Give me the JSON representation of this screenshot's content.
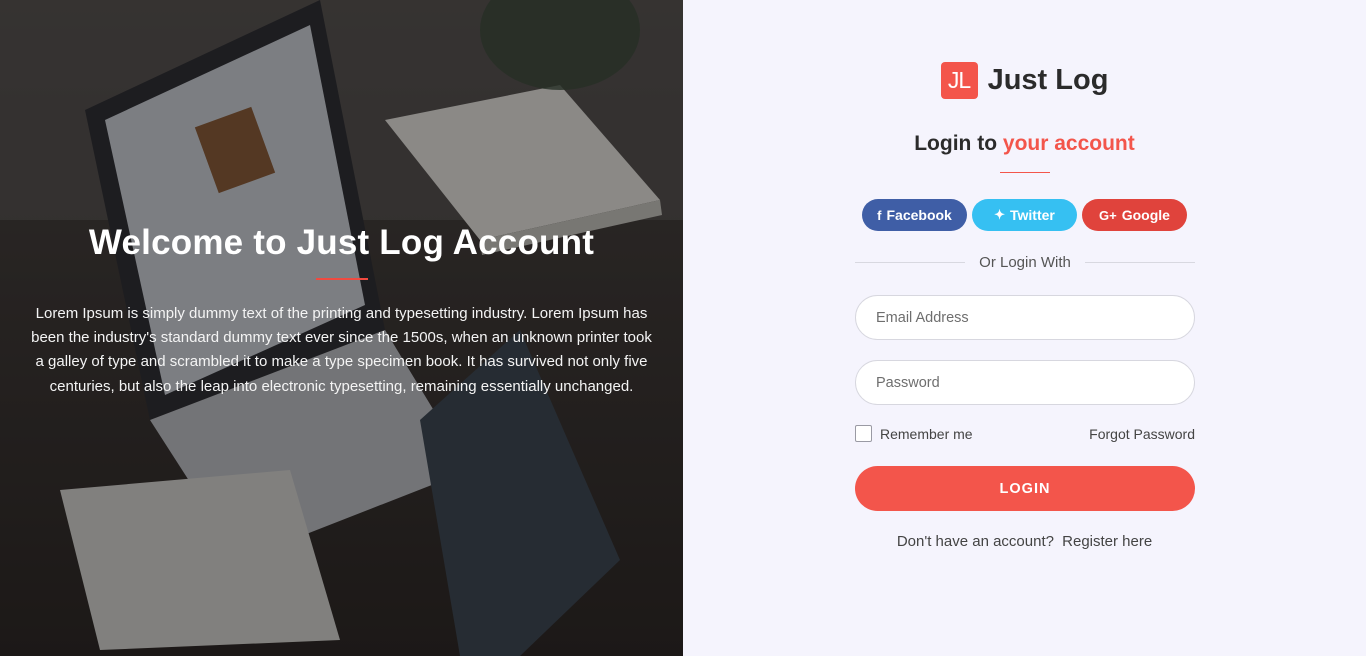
{
  "hero": {
    "title": "Welcome to Just Log Account",
    "description": "Lorem Ipsum is simply dummy text of the printing and typesetting industry. Lorem Ipsum has been the industry's standard dummy text ever since the 1500s, when an unknown printer took a galley of type and scrambled it to make a type specimen book. It has survived not only five centuries, but also the leap into electronic typesetting, remaining essentially unchanged."
  },
  "brand": {
    "logo_text": "JL",
    "name": "Just Log"
  },
  "login": {
    "heading_prefix": "Login to",
    "heading_accent": "your account",
    "social": {
      "facebook": {
        "icon": "f",
        "label": "Facebook"
      },
      "twitter": {
        "icon": "✦",
        "label": "Twitter"
      },
      "google": {
        "icon": "G+",
        "label": "Google"
      }
    },
    "or_text": "Or Login With",
    "email_placeholder": "Email Address",
    "password_placeholder": "Password",
    "remember_label": "Remember me",
    "forgot_label": "Forgot Password",
    "login_button": "LOGIN",
    "signup_prompt": "Don't have an account?",
    "register_link": "Register here"
  },
  "colors": {
    "accent": "#f3554b",
    "facebook": "#3f5ea6",
    "twitter": "#36c0f2",
    "google": "#e0433c",
    "panel_bg": "#f5f4fd"
  }
}
